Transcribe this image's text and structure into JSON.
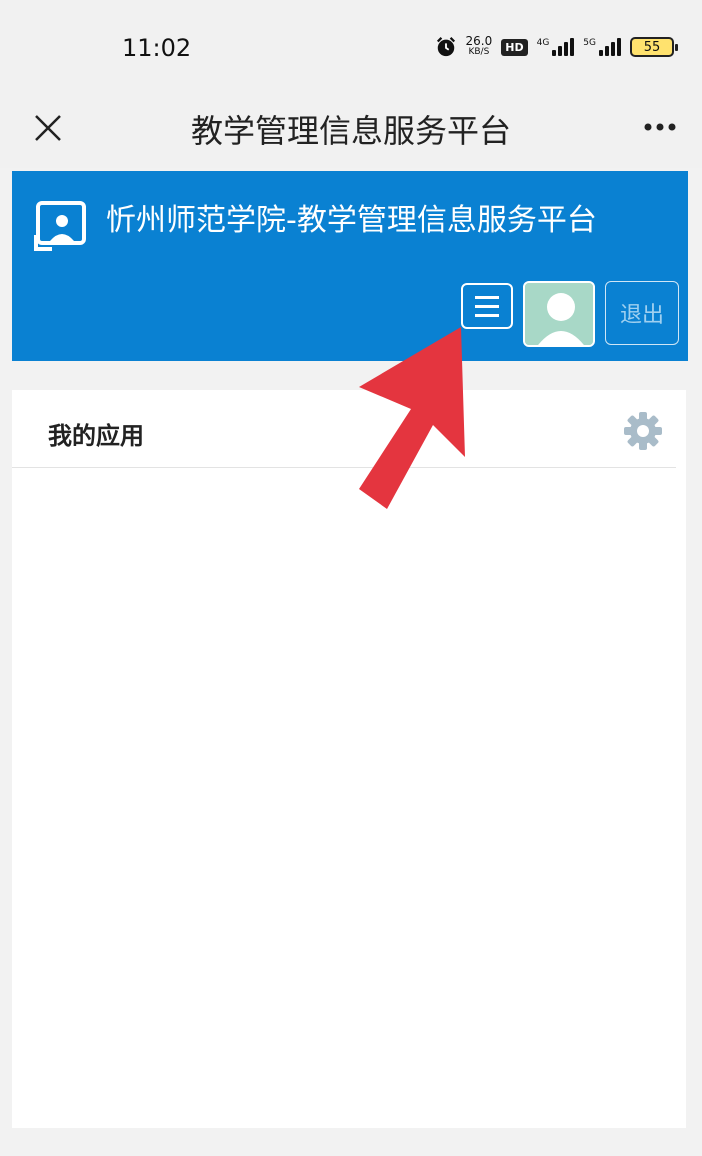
{
  "status_bar": {
    "time": "11:02",
    "net_speed_value": "26.0",
    "net_speed_unit": "KB/S",
    "hd_label": "HD",
    "signal1_label": "4G",
    "signal2_label": "5G",
    "battery": "55",
    "icons": [
      "alarm-icon",
      "signal-icon",
      "battery-icon"
    ]
  },
  "nav_bar": {
    "title": "教学管理信息服务平台",
    "icons": [
      "close-icon",
      "more-icon"
    ]
  },
  "site_header": {
    "title": "忻州师范学院-教学管理信息服务平台",
    "logout_label": "退出",
    "background_color": "#0a81d2",
    "icons": [
      "logo-icon",
      "menu-icon",
      "avatar"
    ]
  },
  "my_apps": {
    "title": "我的应用",
    "icons": [
      "gear-icon"
    ]
  },
  "annotation": {
    "arrow_color": "#e4353f"
  }
}
